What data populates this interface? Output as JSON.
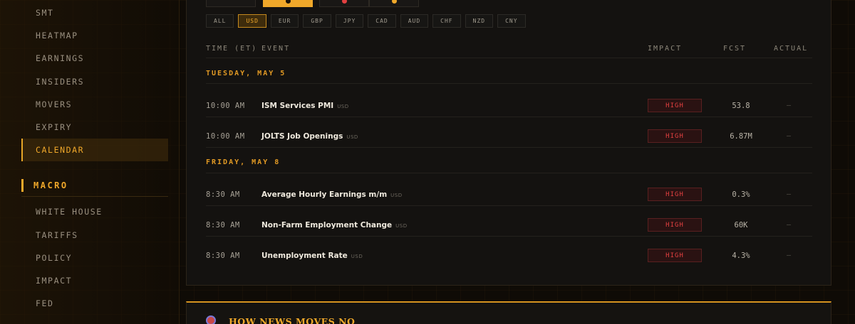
{
  "sidebar": {
    "items_top": [
      "SMT",
      "HEATMAP",
      "EARNINGS",
      "INSIDERS",
      "MOVERS",
      "EXPIRY",
      "CALENDAR"
    ],
    "active_item": "CALENDAR",
    "section": "MACRO",
    "items_bottom": [
      "WHITE HOUSE",
      "TARIFFS",
      "POLICY",
      "IMPACT",
      "FED"
    ]
  },
  "filters": {
    "currencies": [
      "ALL",
      "USD",
      "EUR",
      "GBP",
      "JPY",
      "CAD",
      "AUD",
      "CHF",
      "NZD",
      "CNY"
    ],
    "active_currency": "USD",
    "impact_tab_colors": [
      "#8a8478",
      "#f0a82a",
      "#e24040",
      "#f0a82a"
    ]
  },
  "table": {
    "headers": {
      "time": "TIME (ET)",
      "event": "EVENT",
      "impact": "IMPACT",
      "fcst": "FCST",
      "actual": "ACTUAL"
    },
    "groups": [
      {
        "day": "TUESDAY, MAY 5",
        "events": [
          {
            "time": "10:00 AM",
            "name": "ISM Services PMI",
            "currency": "USD",
            "impact": "HIGH",
            "fcst": "53.8",
            "actual": "—"
          },
          {
            "time": "10:00 AM",
            "name": "JOLTS Job Openings",
            "currency": "USD",
            "impact": "HIGH",
            "fcst": "6.87M",
            "actual": "—"
          }
        ]
      },
      {
        "day": "FRIDAY, MAY 8",
        "events": [
          {
            "time": "8:30 AM",
            "name": "Average Hourly Earnings m/m",
            "currency": "USD",
            "impact": "HIGH",
            "fcst": "0.3%",
            "actual": "—"
          },
          {
            "time": "8:30 AM",
            "name": "Non-Farm Employment Change",
            "currency": "USD",
            "impact": "HIGH",
            "fcst": "60K",
            "actual": "—"
          },
          {
            "time": "8:30 AM",
            "name": "Unemployment Rate",
            "currency": "USD",
            "impact": "HIGH",
            "fcst": "4.3%",
            "actual": "—"
          }
        ]
      }
    ]
  },
  "lower_panel": {
    "title": "HOW NEWS MOVES NQ"
  },
  "colors": {
    "accent": "#f0a82a",
    "impact_high": "#e24040"
  }
}
